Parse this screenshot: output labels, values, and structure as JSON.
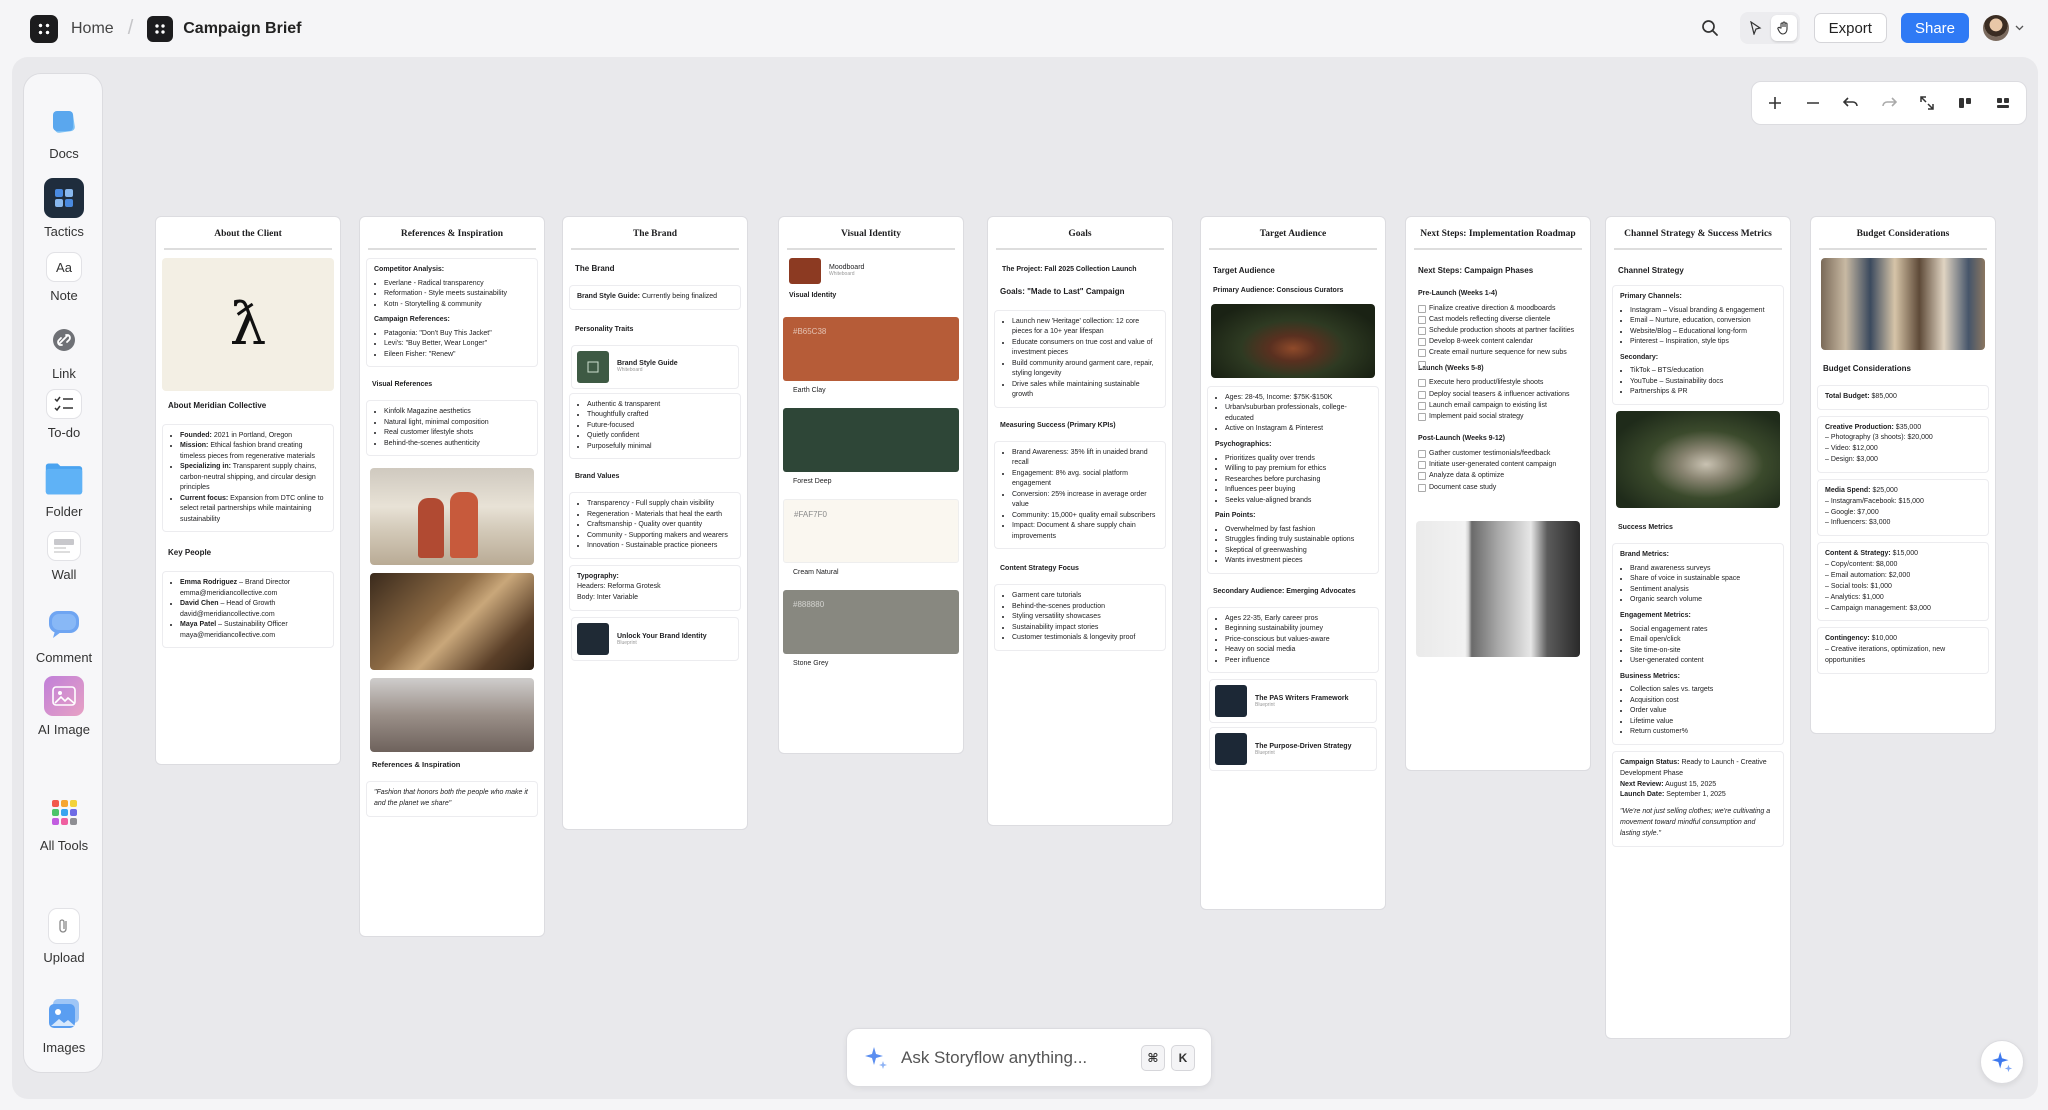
{
  "topbar": {
    "home": "Home",
    "title": "Campaign Brief",
    "export": "Export",
    "share": "Share"
  },
  "sidebar": [
    {
      "label": "Docs",
      "icon": "docs-icon"
    },
    {
      "label": "Tactics",
      "icon": "tactics-icon"
    },
    {
      "label": "Note",
      "icon": "note-icon",
      "glyph": "Aa"
    },
    {
      "label": "Link",
      "icon": "link-icon"
    },
    {
      "label": "To-do",
      "icon": "todo-icon"
    },
    {
      "label": "Folder",
      "icon": "folder-icon"
    },
    {
      "label": "Wall",
      "icon": "wall-icon"
    },
    {
      "label": "Comment",
      "icon": "comment-icon"
    },
    {
      "label": "AI Image",
      "icon": "ai-image-icon"
    },
    {
      "label": "All Tools",
      "icon": "all-tools-icon"
    },
    {
      "label": "Upload",
      "icon": "upload-icon"
    },
    {
      "label": "Images",
      "icon": "images-icon"
    }
  ],
  "ask": {
    "placeholder": "Ask Storyflow anything...",
    "k1": "⌘",
    "k2": "K"
  },
  "c1": {
    "title": "About the Client",
    "logo": "ƛ",
    "name": "About Meridian Collective",
    "founded_l": "Founded:",
    "founded": " 2021 in Portland, Oregon",
    "mission_l": "Mission:",
    "mission": " Ethical fashion brand creating timeless pieces from regenerative materials",
    "spec_l": "Specializing in:",
    "spec": " Transparent supply chains, carbon-neutral shipping, and circular design principles",
    "focus_l": "Current focus:",
    "focus": " Expansion from DTC online to select retail partnerships while maintaining sustainability",
    "key": "Key People",
    "p1n": "Emma Rodriguez",
    "p1r": " – Brand Director",
    "p1e": "emma@meridiancollective.com",
    "p2n": "David Chen",
    "p2r": " – Head of Growth",
    "p2e": "david@meridiancollective.com",
    "p3n": "Maya Patel",
    "p3r": " – Sustainability Officer",
    "p3e": "maya@meridiancollective.com"
  },
  "c2": {
    "title": "References & Inspiration",
    "comp": "Competitor Analysis:",
    "comp_items": [
      "Everlane - Radical transparency",
      "Reformation - Style meets sustainability",
      "Kotn - Storytelling & community"
    ],
    "camp": "Campaign References:",
    "camp_items": [
      "Patagonia: \"Don't Buy This Jacket\"",
      "Levi's: \"Buy Better, Wear Longer\"",
      "Eileen Fisher: \"Renew\""
    ],
    "vis": "Visual References",
    "vis_items": [
      "Kinfolk Magazine aesthetics",
      "Natural light, minimal composition",
      "Real customer lifestyle shots",
      "Behind-the-scenes authenticity"
    ],
    "foot": "References & Inspiration",
    "quote": "\"Fashion that honors both the people who make it and the planet we share\""
  },
  "c3": {
    "title": "The Brand",
    "h": "The Brand",
    "guide_l": "Brand Style Guide:",
    "guide": " Currently being finalized",
    "pers": "Personality Traits",
    "mini1": "Brand Style Guide",
    "mini1s": "Whiteboard",
    "traits": [
      "Authentic & transparent",
      "Thoughtfully crafted",
      "Future-focused",
      "Quietly confident",
      "Purposefully minimal"
    ],
    "vals": "Brand Values",
    "val_items": [
      "Transparency - Full supply chain visibility",
      "Regeneration - Materials that heal the earth",
      "Craftsmanship - Quality over quantity",
      "Community - Supporting makers and wearers",
      "Innovation - Sustainable practice pioneers"
    ],
    "typo_l": "Typography:",
    "typo1": "Headers: Reforma Grotesk",
    "typo2": "Body: Inter Variable",
    "mini2": "Unlock Your Brand Identity",
    "mini2s": "Blueprint"
  },
  "c4": {
    "title": "Visual Identity",
    "mood": "Moodboard",
    "moods": "Whiteboard",
    "vi": "Visual Identity",
    "swatches": [
      {
        "hex": "#B65C38",
        "name": "Earth Clay",
        "color": "#b65c38",
        "tc": "#e4c3b4"
      },
      {
        "hex": "",
        "name": "Forest Deep",
        "color": "#2e4637",
        "tc": "#cfd8d2"
      },
      {
        "hex": "#FAF7F0",
        "name": "Cream Natural",
        "color": "#faf7f0",
        "tc": "#8a8a8a"
      },
      {
        "hex": "#888880",
        "name": "Stone Grey",
        "color": "#888880",
        "tc": "#d4d4d0"
      }
    ]
  },
  "c5": {
    "title": "Goals",
    "proj_l": "The Project:",
    "proj": " Fall 2025 Collection Launch",
    "goal": "Goals: \"Made to Last\" Campaign",
    "goal_items": [
      "Launch new 'Heritage' collection: 12 core pieces for a 10+ year lifespan",
      "Educate consumers on true cost and value of investment pieces",
      "Build community around garment care, repair, styling longevity",
      "Drive sales while maintaining sustainable growth"
    ],
    "meas": "Measuring Success (Primary KPIs)",
    "kpi": [
      "Brand Awareness: 35% lift in unaided brand recall",
      "Engagement: 8% avg. social platform engagement",
      "Conversion: 25% increase in average order value",
      "Community: 15,000+ quality email subscribers",
      "Impact: Document & share supply chain improvements"
    ],
    "cont": "Content Strategy Focus",
    "cont_items": [
      "Garment care tutorials",
      "Behind-the-scenes production",
      "Styling versatility showcases",
      "Sustainability impact stories",
      "Customer testimonials & longevity proof"
    ]
  },
  "c6": {
    "title": "Target Audience",
    "h": "Target Audience",
    "prim": "Primary Audience: Conscious Curators",
    "demo": [
      "Ages: 28-45, Income: $75K-$150K",
      "Urban/suburban professionals, college-educated",
      "Active on Instagram & Pinterest"
    ],
    "psy": "Psychographics:",
    "psy_items": [
      "Prioritizes quality over trends",
      "Willing to pay premium for ethics",
      "Researches before purchasing",
      "Influences peer buying",
      "Seeks value-aligned brands"
    ],
    "pain": "Pain Points:",
    "pain_items": [
      "Overwhelmed by fast fashion",
      "Struggles finding truly sustainable options",
      "Skeptical of greenwashing",
      "Wants investment pieces"
    ],
    "sec": "Secondary Audience: Emerging Advocates",
    "sec_items": [
      "Ages 22-35, Early career pros",
      "Beginning sustainability journey",
      "Price-conscious but values-aware",
      "Heavy on social media",
      "Peer influence"
    ],
    "m1": "The PAS Writers Framework",
    "m1s": "Blueprint",
    "m2": "The Purpose-Driven Strategy",
    "m2s": "Blueprint"
  },
  "c7": {
    "title": "Next Steps: Implementation Roadmap",
    "h": "Next Steps: Campaign Phases",
    "pre": "Pre-Launch (Weeks 1-4)",
    "pre_items": [
      "Finalize creative direction & moodboards",
      "Cast models reflecting diverse clientele",
      "Schedule production shoots at partner facilities",
      "Develop 8-week content calendar",
      "Create email nurture sequence for new subs",
      ""
    ],
    "launch": "Launch (Weeks 5-8)",
    "launch_items": [
      "Execute hero product/lifestyle shoots",
      "Deploy social teasers & influencer activations",
      "Launch email campaign to existing list",
      "Implement paid social strategy"
    ],
    "post": "Post-Launch (Weeks 9-12)",
    "post_items": [
      "Gather customer testimonials/feedback",
      "Initiate user-generated content campaign",
      "Analyze data & optimize",
      "Document case study"
    ]
  },
  "c8": {
    "title": "Channel Strategy & Success Metrics",
    "h": "Channel Strategy",
    "prim": "Primary Channels:",
    "prim_items": [
      "Instagram – Visual branding & engagement",
      "Email – Nurture, education, conversion",
      "Website/Blog – Educational long-form",
      "Pinterest – Inspiration, style tips"
    ],
    "sec": "Secondary:",
    "sec_items": [
      "TikTok – BTS/education",
      "YouTube – Sustainability docs",
      "Partnerships & PR"
    ],
    "succ": "Success Metrics",
    "bm": "Brand Metrics:",
    "bm_items": [
      "Brand awareness surveys",
      "Share of voice in sustainable space",
      "Sentiment analysis",
      "Organic search volume"
    ],
    "em": "Engagement Metrics:",
    "em_items": [
      "Social engagement rates",
      "Email open/click",
      "Site time-on-site",
      "User-generated content"
    ],
    "busm": "Business Metrics:",
    "busm_items": [
      "Collection sales vs. targets",
      "Acquisition cost",
      "Order value",
      "Lifetime value",
      "Return customer%"
    ],
    "status_l": "Campaign Status:",
    "status": " Ready to Launch - Creative Development Phase",
    "review_l": "Next Review:",
    "review": " August 15, 2025",
    "launch_l": "Launch Date:",
    "launch": " September 1, 2025",
    "quote": "\"We're not just selling clothes; we're cultivating a movement toward mindful consumption and lasting style.\""
  },
  "c9": {
    "title": "Budget Considerations",
    "h": "Budget Considerations",
    "total_l": "Total Budget:",
    "total": " $85,000",
    "cp_l": "Creative Production:",
    "cp": " $35,000",
    "cp_items": [
      "– Photography (3 shoots): $20,000",
      "– Video: $12,000",
      "– Design: $3,000"
    ],
    "ms_l": "Media Spend:",
    "ms": " $25,000",
    "ms_items": [
      "– Instagram/Facebook: $15,000",
      "– Google: $7,000",
      "– Influencers: $3,000"
    ],
    "cs_l": "Content & Strategy:",
    "cs": " $15,000",
    "cs_items": [
      "– Copy/content: $8,000",
      "– Email automation: $2,000",
      "– Social tools: $1,000",
      "– Analytics: $1,000",
      "– Campaign management: $3,000"
    ],
    "ct_l": "Contingency:",
    "ct": " $10,000",
    "ct_items": [
      "– Creative iterations, optimization, new opportunities"
    ]
  }
}
